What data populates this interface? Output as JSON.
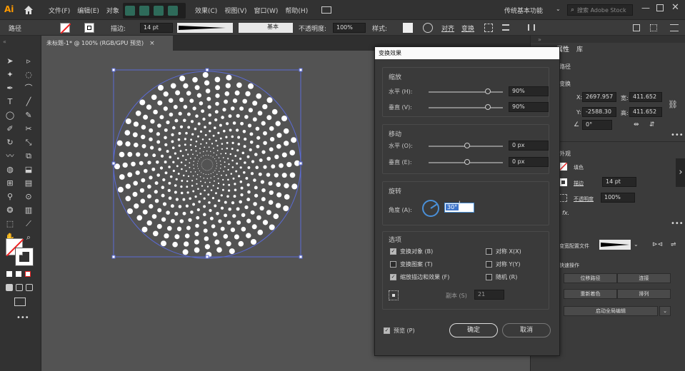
{
  "app": {
    "logo": "Ai"
  },
  "menu": {
    "items": [
      "文件(F)",
      "编辑(E)",
      "对象",
      "效果(C)",
      "视图(V)",
      "窗口(W)",
      "帮助(H)"
    ],
    "workspace": "传统基本功能",
    "search_placeholder": "搜索 Adobe Stock"
  },
  "control": {
    "path_label": "路径",
    "stroke_label": "描边:",
    "stroke_value": "14 pt",
    "basic": "基本",
    "opacity_label": "不透明度:",
    "opacity_value": "100%",
    "style_label": "样式:",
    "align": "对齐",
    "transform": "变换"
  },
  "doc_tab": {
    "title": "未标题-1* @ 100% (RGB/GPU 预览)",
    "close": "×"
  },
  "dialog": {
    "title": "变换效果",
    "scale": {
      "header": "缩放",
      "h_label": "水平 (H):",
      "h_value": "90%",
      "h_frac": 0.8,
      "v_label": "垂直 (V):",
      "v_value": "90%",
      "v_frac": 0.8
    },
    "move": {
      "header": "移动",
      "h_label": "水平 (O):",
      "h_value": "0 px",
      "h_frac": 0.52,
      "v_label": "垂直 (E):",
      "v_value": "0 px",
      "v_frac": 0.52
    },
    "rotate": {
      "header": "旋转",
      "angle_label": "角度 (A):",
      "angle_value": "30°"
    },
    "options": {
      "header": "选项",
      "transform_objects": "变换对象 (B)",
      "transform_patterns": "变换图案 (T)",
      "scale_strokes": "缩放描边和效果 (F)",
      "reflect_x": "对称 X(X)",
      "reflect_y": "对称 Y(Y)",
      "random": "随机 (R)",
      "copies_label": "副本 (S)",
      "copies_value": "21"
    },
    "preview": "预览 (P)",
    "ok": "确定",
    "cancel": "取消",
    "checked": {
      "transform_objects": true,
      "transform_patterns": false,
      "scale_strokes": true,
      "reflect_x": false,
      "reflect_y": false,
      "random": false,
      "preview": true
    }
  },
  "right_panel": {
    "tab_props": "属性",
    "tab_lib": "库",
    "section_path": "路径",
    "section_transform": "变换",
    "x_label": "X:",
    "x_value": "2697.957",
    "y_label": "Y:",
    "y_value": "-2588.30",
    "w_label": "宽:",
    "w_value": "411.652",
    "h_label": "高:",
    "h_value": "411.652",
    "angle_value": "0°",
    "section_appearance": "外观",
    "fill_label": "填色",
    "stroke_label": "描边",
    "stroke_value": "14 pt",
    "opacity_label": "不透明度",
    "opacity_value": "100%",
    "fx": "fx.",
    "profile_label": "变宽配置文件",
    "section_quick": "快速操作",
    "offset_path": "位移路径",
    "join": "连接",
    "recolor": "重新着色",
    "arrange": "排列",
    "global_edit": "启动全局编辑"
  },
  "colors": {
    "accent": "#4a90d9",
    "selection": "#5b6bd6"
  }
}
